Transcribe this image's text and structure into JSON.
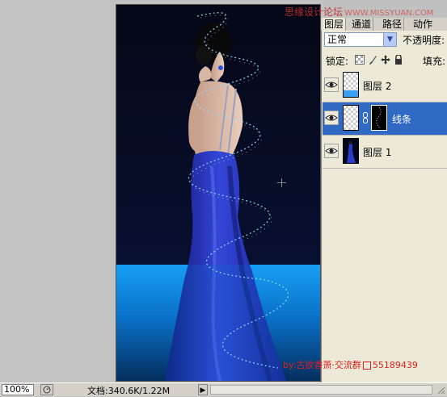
{
  "document": {
    "zoom": "100%",
    "doc_size": "文档:340.6K/1.22M",
    "watermark_top": "思缘设计论坛",
    "watermark_top_url": "WWW.MISSYUAN.COM",
    "watermark_bottom_prefix": "by:古欲香萧·交流群",
    "watermark_bottom_number": "55189439"
  },
  "panel": {
    "tabs": [
      "图层",
      "通道",
      "路径",
      "动作"
    ],
    "active_tab": 0,
    "blend_mode": "正常",
    "opacity_label": "不透明度:",
    "lock_label": "锁定:",
    "fill_label": "填充:",
    "layers": [
      {
        "name": "图层 2",
        "selected": false,
        "visible": true,
        "thumb": "checker-blue"
      },
      {
        "name": "线条",
        "selected": true,
        "visible": true,
        "thumb": "checker",
        "mask": true
      },
      {
        "name": "图层 1",
        "selected": false,
        "visible": true,
        "thumb": "photo"
      }
    ]
  },
  "icons": {
    "eye": "eye-icon",
    "chain": "link-icon",
    "lock_transparency": "lock-transparent-icon",
    "lock_paint": "brush-icon",
    "lock_move": "move-icon",
    "lock_all": "lock-icon",
    "dropdown": "chevron-down-icon"
  },
  "colors": {
    "selection": "#316ac5",
    "panel_bg": "#ece9d8",
    "canvas_blue": "#1aa6f7",
    "dress_blue": "#2233b0"
  }
}
